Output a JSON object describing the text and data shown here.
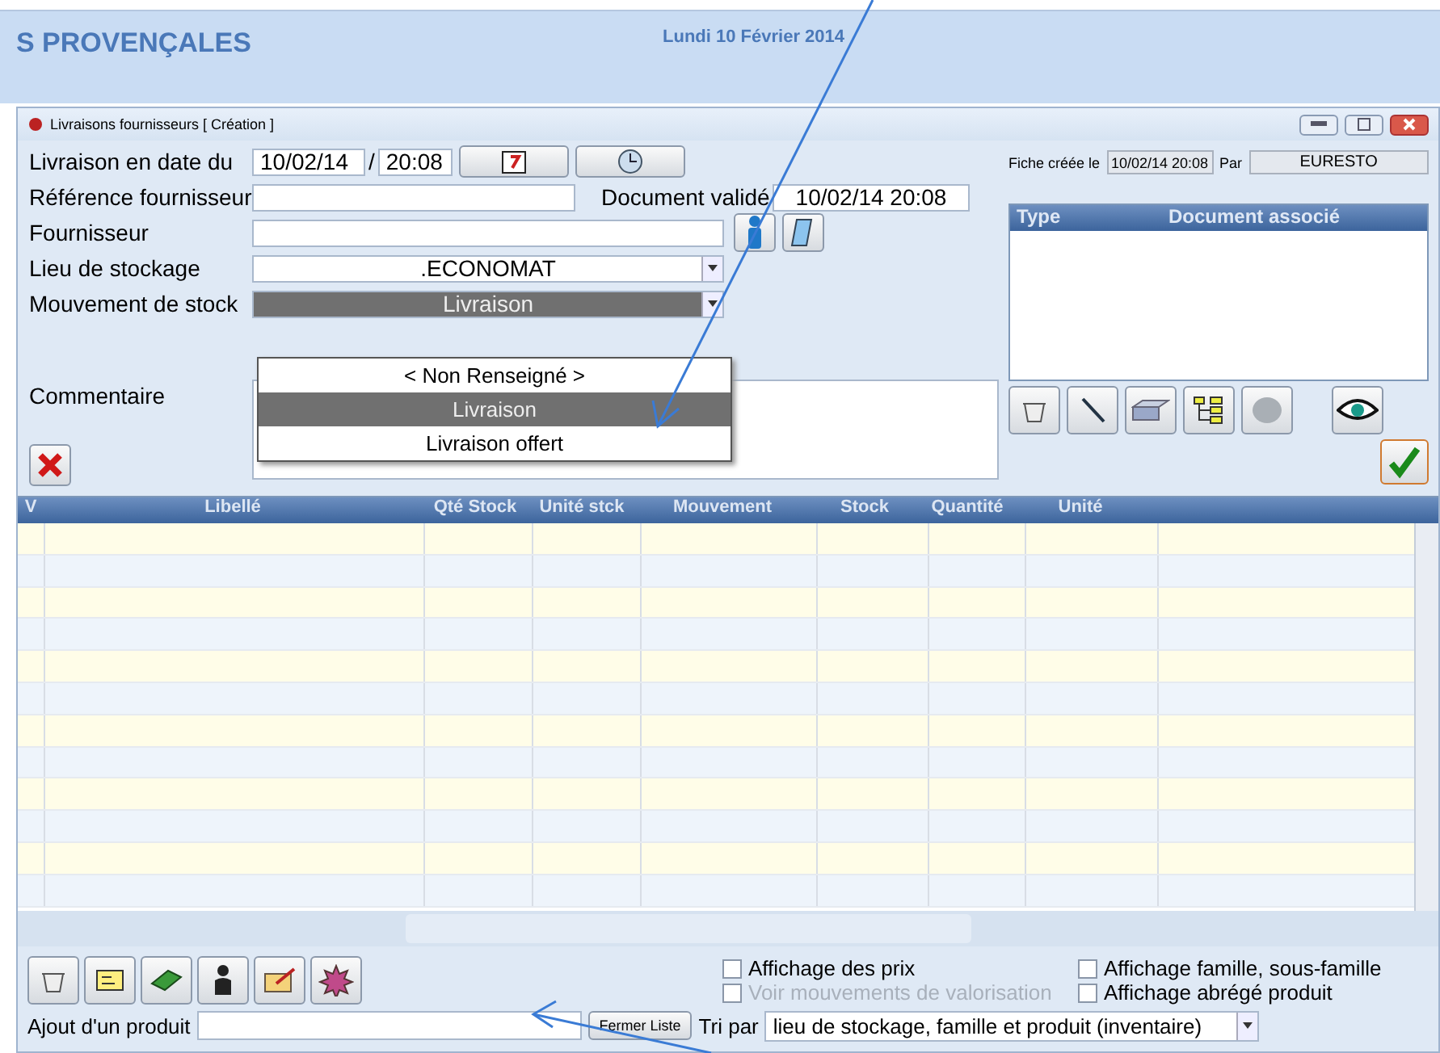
{
  "banner": {
    "title": "S PROVENÇALES",
    "date": "Lundi 10 Février 2014"
  },
  "window": {
    "title": "Livraisons fournisseurs  [ Création ]"
  },
  "form": {
    "delivery_date": {
      "label": "Livraison en date du",
      "date": "10/02/14",
      "separator": "/",
      "time": "20:08"
    },
    "reference": {
      "label": "Référence fournisseur"
    },
    "validated": {
      "label": "Document validé",
      "value": "10/02/14 20:08"
    },
    "supplier": {
      "label": "Fournisseur"
    },
    "storage": {
      "label": "Lieu de stockage",
      "value": ".ECONOMAT"
    },
    "movement": {
      "label": "Mouvement de stock",
      "value": "Livraison"
    },
    "movement_options": [
      {
        "label": "< Non Renseigné >",
        "selected": false
      },
      {
        "label": "Livraison",
        "selected": true
      },
      {
        "label": "Livraison offert",
        "selected": false
      }
    ],
    "comment": {
      "label": "Commentaire"
    }
  },
  "record": {
    "created_label": "Fiche créée le",
    "created_value": "10/02/14 20:08",
    "by_label": "Par",
    "by_value": "EURESTO"
  },
  "documents": {
    "columns": [
      "Type",
      "Document associé"
    ]
  },
  "grid": {
    "columns": [
      "V",
      "Libellé",
      "Qté Stock",
      "Unité stck",
      "Mouvement",
      "Stock",
      "Quantité",
      "Unité"
    ]
  },
  "options": [
    {
      "label": "Affichage des prix",
      "checked": false,
      "disabled": false
    },
    {
      "label": "Affichage famille, sous-famille",
      "checked": false,
      "disabled": false
    },
    {
      "label": "Voir mouvements de valorisation",
      "checked": false,
      "disabled": true
    },
    {
      "label": "Affichage abrégé produit",
      "checked": false,
      "disabled": false
    }
  ],
  "add_product": {
    "label": "Ajout d'un produit",
    "button": "Fermer Liste"
  },
  "sort": {
    "label": "Tri par",
    "value": "lieu de stockage, famille et produit (inventaire)"
  }
}
